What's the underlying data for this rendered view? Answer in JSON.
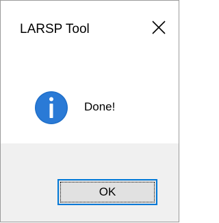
{
  "window": {
    "title": "LARSP Tool"
  },
  "message": {
    "icon": "info-icon",
    "text": "Done!"
  },
  "buttons": {
    "ok_label": "OK"
  },
  "colors": {
    "accent": "#0078d7",
    "footer_bg": "#f0f0f0",
    "button_bg": "#e1e1e1"
  }
}
